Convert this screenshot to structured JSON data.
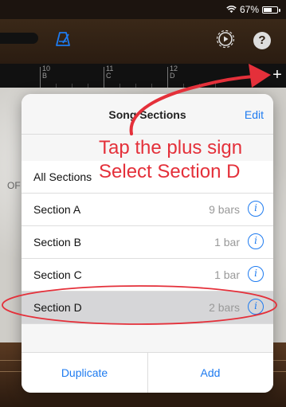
{
  "status": {
    "battery_text": "67%",
    "battery_level": 0.67
  },
  "toolbar": {
    "icons": [
      "metronome-icon",
      "settings-gear-icon",
      "help-icon"
    ],
    "help_label": "?"
  },
  "ruler": {
    "marks": [
      {
        "num": "10",
        "sub": "B"
      },
      {
        "num": "11",
        "sub": "C"
      },
      {
        "num": "12",
        "sub": "D"
      }
    ],
    "plus_label": "+"
  },
  "track_label": "OF",
  "popover": {
    "title": "Song Sections",
    "edit_label": "Edit",
    "sections": [
      {
        "name": "All Sections",
        "bars": ""
      },
      {
        "name": "Section A",
        "bars": "9 bars"
      },
      {
        "name": "Section B",
        "bars": "1 bar"
      },
      {
        "name": "Section C",
        "bars": "1 bar"
      },
      {
        "name": "Section D",
        "bars": "2 bars",
        "selected": true
      }
    ],
    "info_glyph": "i",
    "duplicate_label": "Duplicate",
    "add_label": "Add"
  },
  "annotations": {
    "line1": "Tap the plus sign",
    "line2": "Select Section D",
    "color": "#e4303a"
  },
  "colors": {
    "accent": "#1e7bf0"
  }
}
